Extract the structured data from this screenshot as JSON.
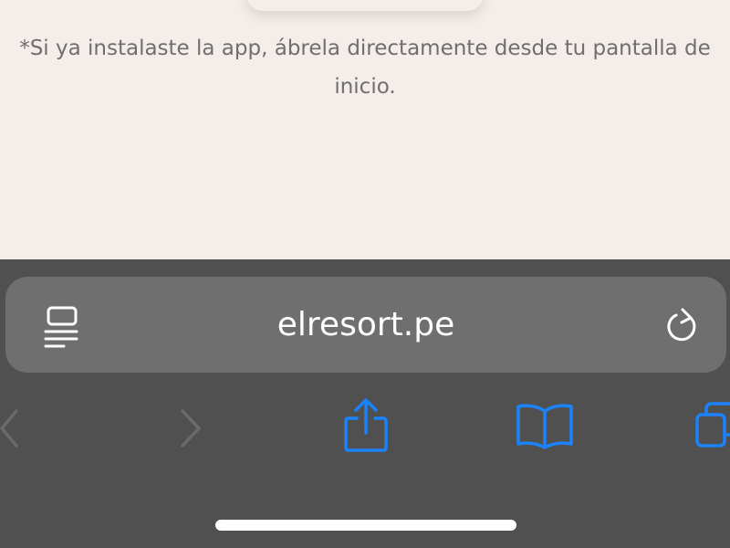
{
  "page": {
    "note": "*Si ya instalaste la app, ábrela directamente desde tu pantalla de inicio."
  },
  "browser": {
    "url": "elresort.pe",
    "icons": {
      "reader": "reader-mode-icon",
      "reload": "reload-icon",
      "back": "chevron-left-icon",
      "forward": "chevron-right-icon",
      "share": "share-icon",
      "bookmarks": "bookmarks-book-icon",
      "tabs": "tabs-icon"
    }
  },
  "colors": {
    "page_background": "#f4ede9",
    "toolbar_background": "#505050",
    "address_bar": "#6f6f6f",
    "accent": "#1a82fb",
    "disabled": "#6a6a6a"
  }
}
